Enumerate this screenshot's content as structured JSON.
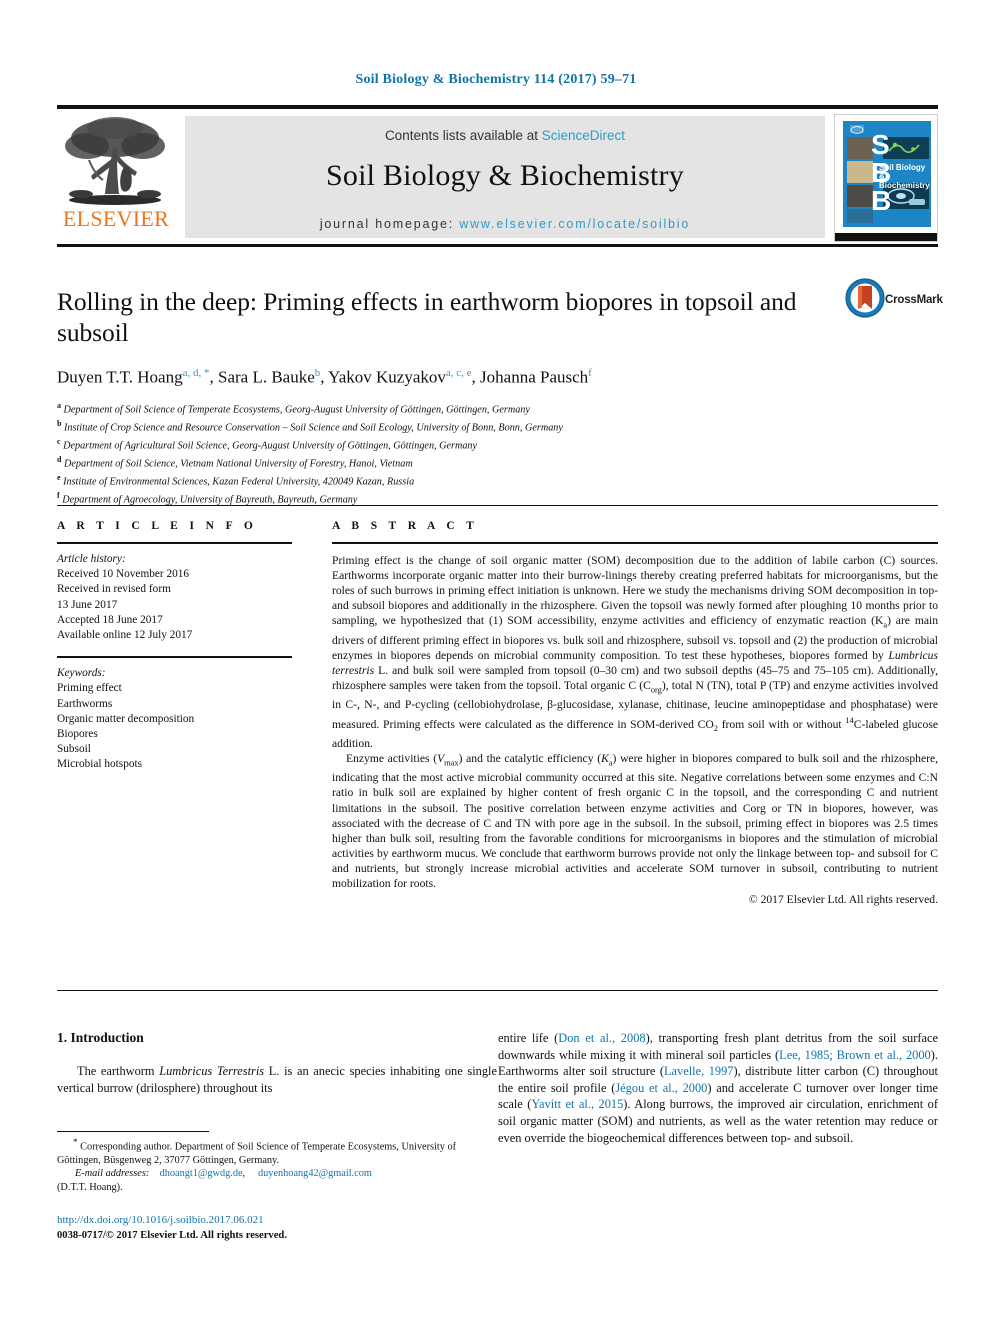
{
  "running_head": "Soil Biology & Biochemistry 114 (2017) 59–71",
  "colors": {
    "link": "#1273a8",
    "sciencedirect": "#2e9bc8",
    "elsevier_orange": "#E87722",
    "masthead_grey": "#e4e4e4",
    "cover_blue": "#1d85c4",
    "crossmark_red": "#c8401f"
  },
  "masthead": {
    "publisher_name": "ELSEVIER",
    "contents_prefix": "Contents lists available at ",
    "contents_link": "ScienceDirect",
    "journal_title": "Soil Biology & Biochemistry",
    "homepage_prefix": "journal homepage: ",
    "homepage_url": "www.elsevier.com/locate/soilbio",
    "cover": {
      "letters": [
        "S",
        "B",
        "B"
      ],
      "title": "Soil Biology & Biochemistry"
    }
  },
  "article": {
    "title": "Rolling in the deep: Priming effects in earthworm biopores in topsoil and subsoil",
    "authors": [
      {
        "name": "Duyen T.T. Hoang",
        "marks": "a, d, *"
      },
      {
        "name": "Sara L. Bauke",
        "marks": "b"
      },
      {
        "name": "Yakov Kuzyakov",
        "marks": "a, c, e"
      },
      {
        "name": "Johanna Pausch",
        "marks": "f"
      }
    ],
    "affiliations": [
      {
        "mark": "a",
        "text": "Department of Soil Science of Temperate Ecosystems, Georg-August University of Göttingen, Göttingen, Germany"
      },
      {
        "mark": "b",
        "text": "Institute of Crop Science and Resource Conservation – Soil Science and Soil Ecology, University of Bonn, Bonn, Germany"
      },
      {
        "mark": "c",
        "text": "Department of Agricultural Soil Science, Georg-August University of Göttingen, Göttingen, Germany"
      },
      {
        "mark": "d",
        "text": "Department of Soil Science, Vietnam National University of Forestry, Hanoi, Vietnam"
      },
      {
        "mark": "e",
        "text": "Institute of Environmental Sciences, Kazan Federal University, 420049 Kazan, Russia"
      },
      {
        "mark": "f",
        "text": "Department of Agroecology, University of Bayreuth, Bayreuth, Germany"
      }
    ],
    "crossmark_label": "CrossMark"
  },
  "article_info": {
    "heading": "A R T I C L E   I N F O",
    "history_label": "Article history:",
    "history": [
      "Received 10 November 2016",
      "Received in revised form",
      "13 June 2017",
      "Accepted 18 June 2017",
      "Available online 12 July 2017"
    ],
    "keywords_label": "Keywords:",
    "keywords": [
      "Priming effect",
      "Earthworms",
      "Organic matter decomposition",
      "Biopores",
      "Subsoil",
      "Microbial hotspots"
    ]
  },
  "abstract": {
    "heading": "A B S T R A C T",
    "paragraph1_a": "Priming effect is the change of soil organic matter (SOM) decomposition due to the addition of labile carbon (C) sources. Earthworms incorporate organic matter into their burrow-linings thereby creating preferred habitats for microorganisms, but the roles of such burrows in priming effect initiation is unknown. Here we study the mechanisms driving SOM decomposition in top- and subsoil biopores and additionally in the rhizosphere. Given the topsoil was newly formed after ploughing 10 months prior to sampling, we hypothesized that (1) SOM accessibility, enzyme activities and efficiency of enzymatic reaction (K",
    "paragraph1_sub1": "a",
    "paragraph1_b": ") are main drivers of different priming effect in biopores vs. bulk soil and rhizosphere, subsoil vs. topsoil and (2) the production of microbial enzymes in biopores depends on microbial community composition. To test these hypotheses, biopores formed by ",
    "paragraph1_italic1": "Lumbricus terrestris",
    "paragraph1_c": " L. and bulk soil were sampled from topsoil (0–30 cm) and two subsoil depths (45–75 and 75–105 cm). Additionally, rhizosphere samples were taken from the topsoil. Total organic C (C",
    "paragraph1_sub2": "org",
    "paragraph1_d": "), total N (TN), total P (TP) and enzyme activities involved in C-, N-, and P-cycling (cellobiohydrolase, β-glucosidase, xylanase, chitinase, leucine aminopeptidase and phosphatase) were measured. Priming effects were calculated as the difference in SOM-derived CO",
    "paragraph1_sub3": "2",
    "paragraph1_e": " from soil with or without ",
    "paragraph1_sup1": "14",
    "paragraph1_f": "C-labeled glucose addition.",
    "paragraph2_a": "Enzyme activities (",
    "paragraph2_v": "V",
    "paragraph2_vsub": "max",
    "paragraph2_b": ") and the catalytic efficiency (",
    "paragraph2_k": "K",
    "paragraph2_ksub": "a",
    "paragraph2_c": ") were higher in biopores compared to bulk soil and the rhizosphere, indicating that the most active microbial community occurred at this site. Negative correlations between some enzymes and C:N ratio in bulk soil are explained by higher content of fresh organic C in the topsoil, and the corresponding C and nutrient limitations in the subsoil. The positive correlation between enzyme activities and Corg or TN in biopores, however, was associated with the decrease of C and TN with pore age in the subsoil. In the subsoil, priming effect in biopores was 2.5 times higher than bulk soil, resulting from the favorable conditions for microorganisms in biopores and the stimulation of microbial activities by earthworm mucus. We conclude that earthworm burrows provide not only the linkage between top- and subsoil for C and nutrients, but strongly increase microbial activities and accelerate SOM turnover in subsoil, contributing to nutrient mobilization for roots.",
    "copyright": "© 2017 Elsevier Ltd. All rights reserved."
  },
  "introduction": {
    "heading": "1. Introduction",
    "left_a": "The earthworm ",
    "left_italic": "Lumbricus Terrestris",
    "left_b": " L. is an anecic species inhabiting one single vertical burrow (drilosphere) throughout its",
    "right_parts": [
      {
        "t": "entire life (",
        "k": "plain"
      },
      {
        "t": "Don et al., 2008",
        "k": "cite"
      },
      {
        "t": "), transporting fresh plant detritus from the soil surface downwards while mixing it with mineral soil particles (",
        "k": "plain"
      },
      {
        "t": "Lee, 1985; Brown et al., 2000",
        "k": "cite"
      },
      {
        "t": "). Earthworms alter soil structure (",
        "k": "plain"
      },
      {
        "t": "Lavelle, 1997",
        "k": "cite"
      },
      {
        "t": "), distribute litter carbon (C) throughout the entire soil profile (",
        "k": "plain"
      },
      {
        "t": "Jégou et al., 2000",
        "k": "cite"
      },
      {
        "t": ") and accelerate C turnover over longer time scale (",
        "k": "plain"
      },
      {
        "t": "Yavitt et al., 2015",
        "k": "cite"
      },
      {
        "t": "). Along burrows, the improved air circulation, enrichment of soil organic matter (SOM) and nutrients, as well as the water retention may reduce or even override the biogeochemical differences between top- and subsoil.",
        "k": "plain"
      }
    ]
  },
  "footnotes": {
    "corresponding": "Corresponding author. Department of Soil Science of Temperate Ecosystems, University of Göttingen, Büsgenweg 2, 37077 Göttingen, Germany.",
    "email_label": "E-mail addresses:",
    "email1": "dhoangt1@gwdg.de",
    "email_sep": ", ",
    "email2": "duyenhoang42@gmail.com",
    "email_owner": "(D.T.T. Hoang).",
    "doi": "http://dx.doi.org/10.1016/j.soilbio.2017.06.021",
    "issn_line": "0038-0717/© 2017 Elsevier Ltd. All rights reserved."
  }
}
